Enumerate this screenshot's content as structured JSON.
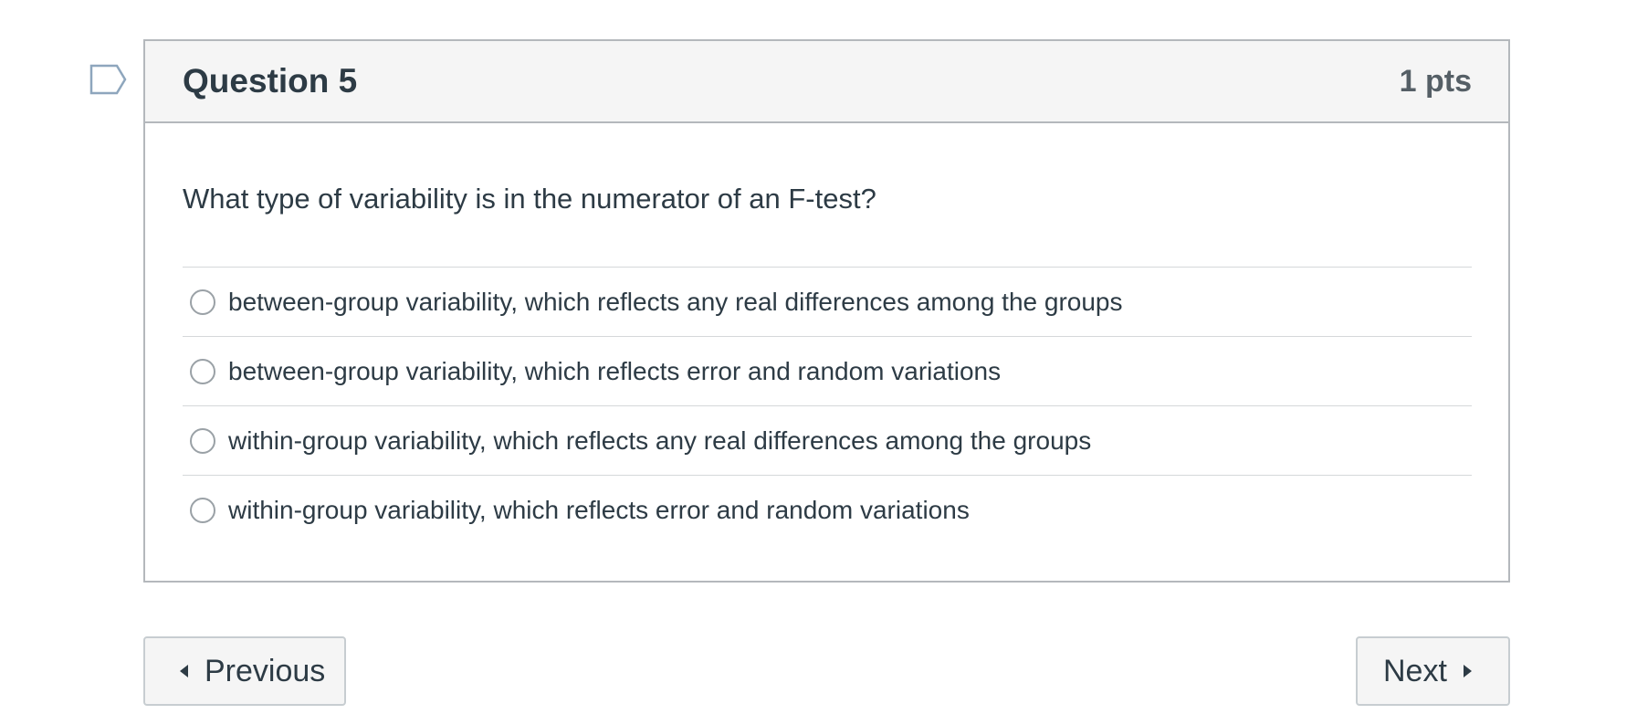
{
  "question": {
    "title": "Question 5",
    "points": "1 pts",
    "text": "What type of variability is in the numerator of an F-test?",
    "answers": [
      {
        "label": "between-group variability, which reflects any real differences among the groups",
        "selected": false
      },
      {
        "label": "between-group variability, which reflects error and random variations",
        "selected": false
      },
      {
        "label": "within-group variability, which reflects any real differences among the groups",
        "selected": false
      },
      {
        "label": "within-group variability, which reflects error and random variations",
        "selected": false
      }
    ]
  },
  "navigation": {
    "previous_label": "Previous",
    "next_label": "Next"
  },
  "icons": {
    "flag": "flag-icon",
    "previous": "caret-left-icon",
    "next": "caret-right-icon"
  },
  "colors": {
    "text": "#2d3b45",
    "header_background": "#f5f5f5",
    "border": "#b4b8bc",
    "flag_outline": "#8ea6bd"
  }
}
